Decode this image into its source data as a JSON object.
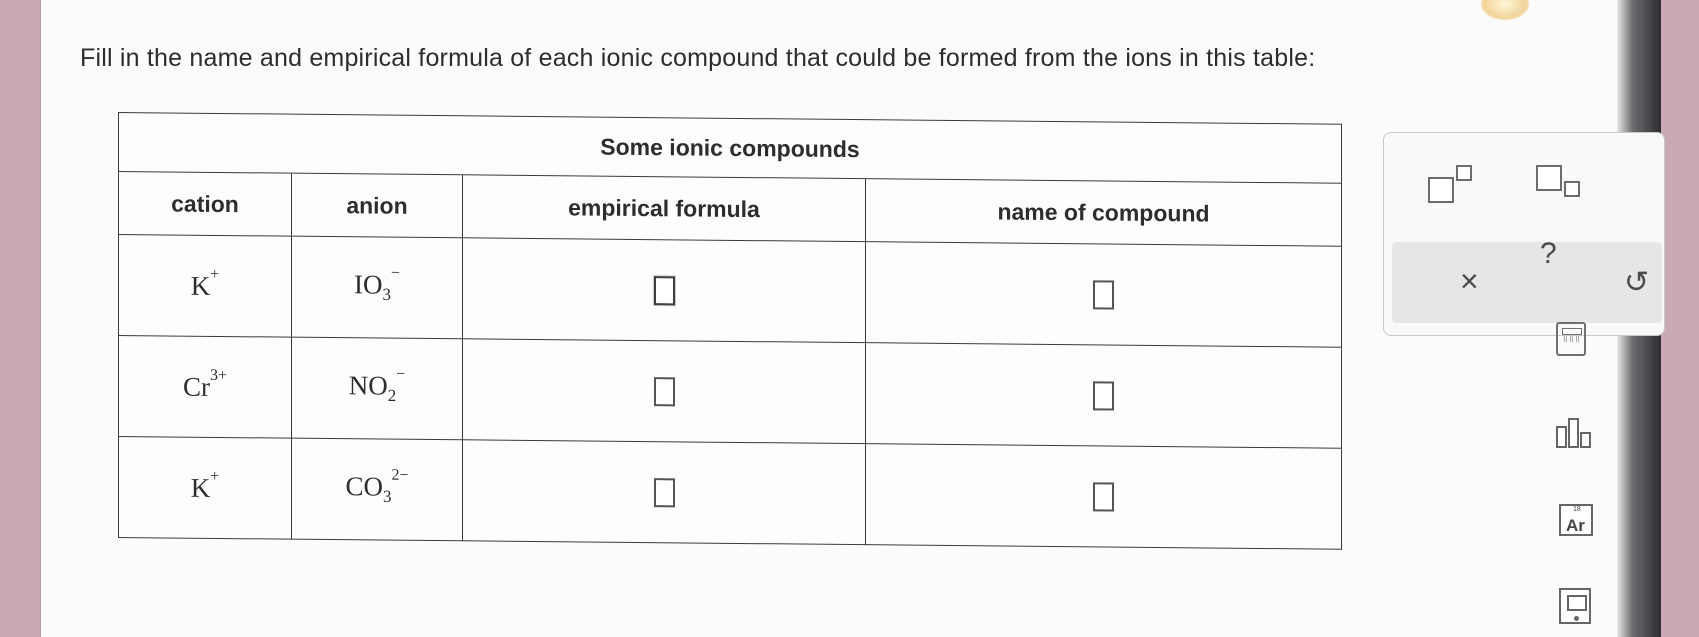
{
  "question": "Fill in the name and empirical formula of each ionic compound that could be formed from the ions in this table:",
  "table": {
    "title": "Some ionic compounds",
    "headers": [
      "cation",
      "anion",
      "empirical formula",
      "name of compound"
    ],
    "rows": [
      {
        "cation": {
          "base": "K",
          "charge": "+"
        },
        "anion": {
          "base": "IO",
          "sub": "3",
          "charge": "−"
        }
      },
      {
        "cation": {
          "base": "Cr",
          "charge": "3+"
        },
        "anion": {
          "base": "NO",
          "sub": "2",
          "charge": "−"
        }
      },
      {
        "cation": {
          "base": "K",
          "charge": "+"
        },
        "anion": {
          "base": "CO",
          "sub": "3",
          "charge": "2−"
        }
      }
    ]
  },
  "palette": {
    "clear_icon": "×",
    "help_icon": "?",
    "undo_icon": "↺"
  },
  "tools": {
    "periodic_number": "18",
    "periodic_symbol": "Ar",
    "calculator_keys": "⠿⠿⠿"
  }
}
